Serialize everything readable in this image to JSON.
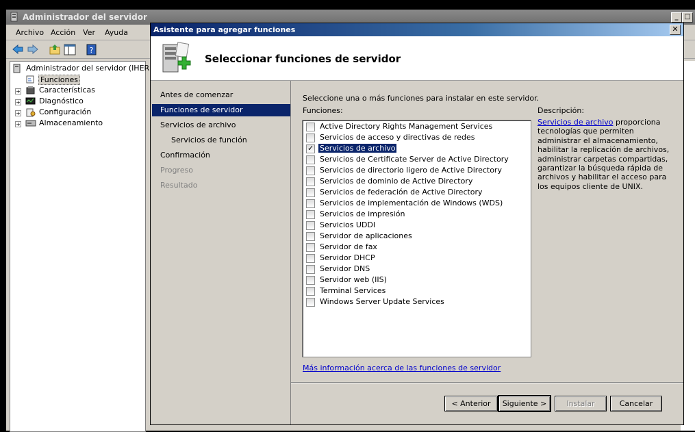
{
  "main_window": {
    "title": "Administrador del servidor",
    "menu": [
      "Archivo",
      "Acción",
      "Ver",
      "Ayuda"
    ],
    "tree": {
      "root": "Administrador del servidor (IHERRE",
      "items": [
        "Funciones",
        "Características",
        "Diagnóstico",
        "Configuración",
        "Almacenamiento"
      ]
    }
  },
  "wizard": {
    "title": "Asistente para agregar funciones",
    "heading": "Seleccionar funciones de servidor",
    "nav": [
      {
        "label": "Antes de comenzar",
        "state": "normal"
      },
      {
        "label": "Funciones de servidor",
        "state": "selected"
      },
      {
        "label": "Servicios de archivo",
        "state": "normal"
      },
      {
        "label": "Servicios de función",
        "state": "normal"
      },
      {
        "label": "Confirmación",
        "state": "normal"
      },
      {
        "label": "Progreso",
        "state": "disabled"
      },
      {
        "label": "Resultado",
        "state": "disabled"
      }
    ],
    "instruction": "Seleccione una o más funciones para instalar en este servidor.",
    "roles_label": "Funciones:",
    "roles": [
      {
        "label": "Active Directory Rights Management Services",
        "checked": false
      },
      {
        "label": "Servicios de acceso y directivas de redes",
        "checked": false
      },
      {
        "label": "Servicios de archivo",
        "checked": true
      },
      {
        "label": "Servicios de Certificate Server de Active Directory",
        "checked": false
      },
      {
        "label": "Servicios de directorio ligero de Active Directory",
        "checked": false
      },
      {
        "label": "Servicios de dominio de Active Directory",
        "checked": false
      },
      {
        "label": "Servicios de federación de Active Directory",
        "checked": false
      },
      {
        "label": "Servicios de implementación de Windows (WDS)",
        "checked": false
      },
      {
        "label": "Servicios de impresión",
        "checked": false
      },
      {
        "label": "Servicios UDDI",
        "checked": false
      },
      {
        "label": "Servidor de aplicaciones",
        "checked": false
      },
      {
        "label": "Servidor de fax",
        "checked": false
      },
      {
        "label": "Servidor DHCP",
        "checked": false
      },
      {
        "label": "Servidor DNS",
        "checked": false
      },
      {
        "label": "Servidor web (IIS)",
        "checked": false
      },
      {
        "label": "Terminal Services",
        "checked": false
      },
      {
        "label": "Windows Server Update Services",
        "checked": false
      }
    ],
    "more_info": "Más información acerca de las funciones de servidor",
    "description_title": "Descripción:",
    "description_link": "Servicios de archivo",
    "description_text": "proporciona tecnologías que permiten administrar el almacenamiento, habilitar la replicación de archivos, administrar carpetas compartidas, garantizar la búsqueda rápida de archivos y habilitar el acceso para los equipos cliente de UNIX.",
    "buttons": {
      "back": "< Anterior",
      "next": "Siguiente >",
      "install": "Instalar",
      "cancel": "Cancelar"
    }
  }
}
